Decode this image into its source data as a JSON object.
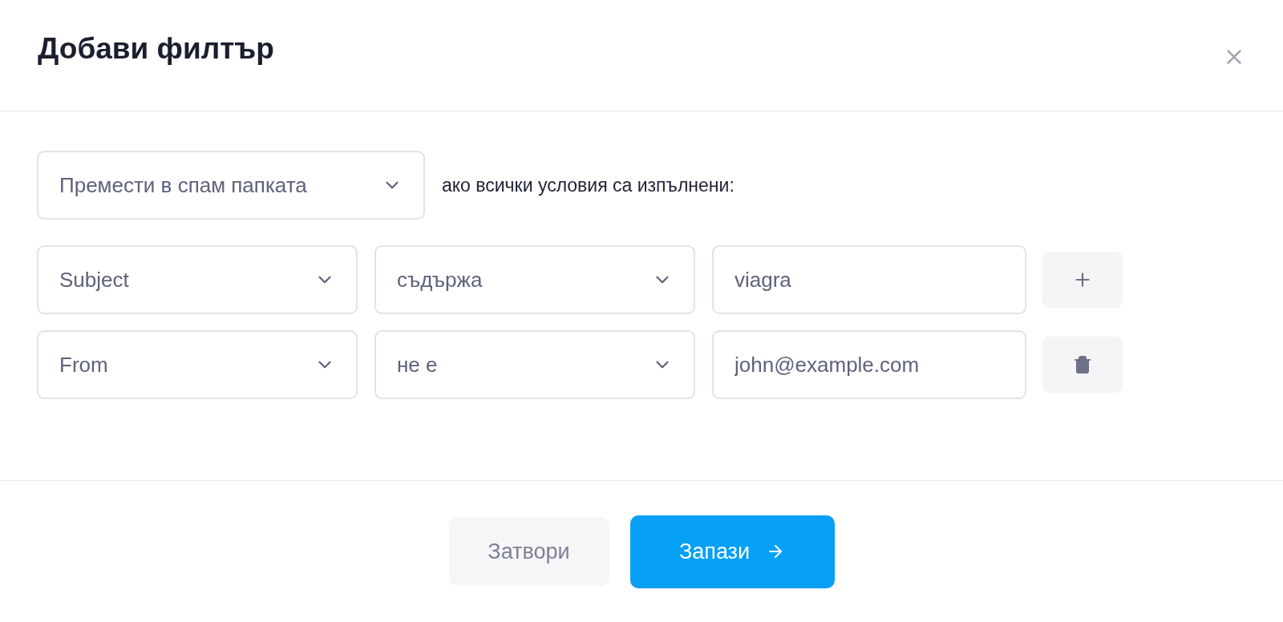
{
  "dialog": {
    "title": "Добави филтър"
  },
  "action": {
    "value": "Премести в спам папката"
  },
  "condition_text": "ако всички условия са изпълнени:",
  "conditions": [
    {
      "field": "Subject",
      "operator": "съдържа",
      "value": "viagra",
      "kind": "add"
    },
    {
      "field": "From",
      "operator": "не е",
      "value": "john@example.com",
      "kind": "delete"
    }
  ],
  "buttons": [
    {
      "label": "Затвори",
      "kind": "secondary"
    },
    {
      "label": "Запази",
      "kind": "primary"
    }
  ]
}
